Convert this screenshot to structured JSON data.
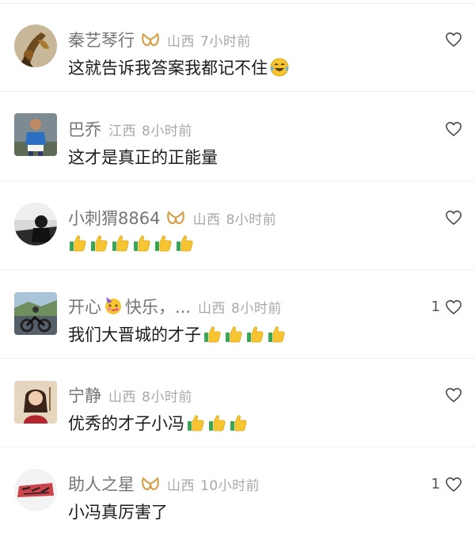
{
  "comments": [
    {
      "name": "秦艺琴行",
      "badge": true,
      "location": "山西",
      "time": "7小时前",
      "text": "这就告诉我答案我都记不住",
      "likes": "",
      "thumbs": 0,
      "emoji": "laughing-crying"
    },
    {
      "name": "巴乔",
      "badge": false,
      "location": "江西",
      "time": "8小时前",
      "text": "这才是真正的正能量",
      "likes": "",
      "thumbs": 0
    },
    {
      "name": "小刺猬8864",
      "badge": true,
      "location": "山西",
      "time": "8小时前",
      "text": "",
      "likes": "",
      "thumbs": 6
    },
    {
      "name_pre": "开心",
      "name_post": "快乐，...",
      "badge": false,
      "location": "山西",
      "time": "8小时前",
      "text": "我们大晋城的才子",
      "likes": "1",
      "thumbs": 4,
      "name_emoji": "party-face"
    },
    {
      "name": "宁静",
      "badge": false,
      "location": "山西",
      "time": "8小时前",
      "text": "优秀的才子小冯",
      "likes": "",
      "thumbs": 3
    },
    {
      "name": "助人之星",
      "badge": true,
      "location": "山西",
      "time": "10小时前",
      "text": "小冯真厉害了",
      "likes": "1",
      "thumbs": 0
    }
  ],
  "colors": {
    "name": "#757575",
    "meta": "#a8a8a8",
    "text": "#1c1c1c",
    "badge": "#d9a04a",
    "divider": "#f0f0f0"
  },
  "icons": [
    "heart-outline-icon",
    "thumbs-up-icon",
    "creator-badge-icon"
  ]
}
